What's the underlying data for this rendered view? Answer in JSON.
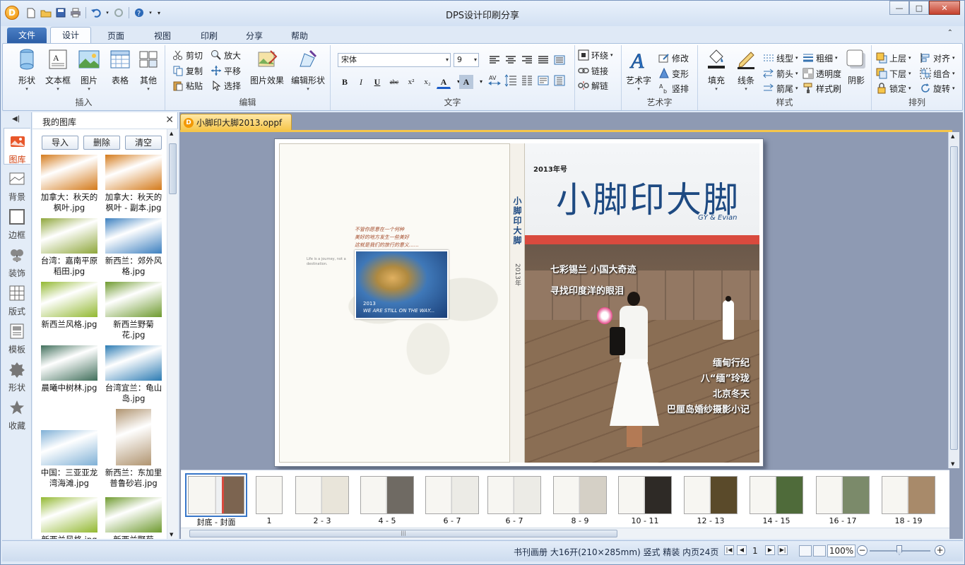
{
  "window": {
    "title": "DPS设计印刷分享",
    "logo_letter": "D",
    "minimize": "—",
    "maximize": "□",
    "close": "✕"
  },
  "ribbon_tabs": {
    "file": "文件",
    "tabs": [
      "设计",
      "页面",
      "视图",
      "印刷",
      "分享",
      "帮助"
    ],
    "active": "设计"
  },
  "groups": {
    "insert": {
      "label": "插入",
      "shape": "形状",
      "textbox": "文本框",
      "image": "图片",
      "table": "表格",
      "other": "其他"
    },
    "edit": {
      "label": "编辑",
      "cut": "剪切",
      "copy": "复制",
      "paste": "粘贴",
      "zoom": "放大",
      "pan": "平移",
      "select": "选择",
      "image_effect": "图片效果",
      "edit_shape": "编辑形状"
    },
    "text": {
      "label": "文字",
      "font": "宋体",
      "size": "9",
      "bold": "B",
      "italic": "I",
      "underline": "U",
      "strike": "abc",
      "superscript": "x²",
      "subscript": "x₂",
      "font_color": "A",
      "highlight": "A",
      "wrap": "环绕",
      "link": "链接",
      "unlink": "解链"
    },
    "art": {
      "label": "艺术字",
      "arttext": "艺术字",
      "modify": "修改",
      "transform": "变形",
      "vertical": "竖排"
    },
    "style": {
      "label": "样式",
      "fill": "填充",
      "line": "线条",
      "linetype": "线型",
      "arrow": "箭头",
      "tail": "箭尾",
      "weight": "粗细",
      "transparency": "透明度",
      "format_brush": "样式刷",
      "shadow": "阴影"
    },
    "arrange": {
      "label": "排列",
      "up": "上层",
      "down": "下层",
      "lock": "锁定",
      "align": "对齐",
      "group": "组合",
      "rotate": "旋转"
    }
  },
  "left_tabs": [
    {
      "label": "图库",
      "icon": "gallery-icon"
    },
    {
      "label": "背景",
      "icon": "background-icon"
    },
    {
      "label": "边框",
      "icon": "border-icon"
    },
    {
      "label": "装饰",
      "icon": "decoration-icon"
    },
    {
      "label": "版式",
      "icon": "layout-icon"
    },
    {
      "label": "模板",
      "icon": "template-icon"
    },
    {
      "label": "形状",
      "icon": "shape-icon"
    },
    {
      "label": "收藏",
      "icon": "star-icon"
    }
  ],
  "gallery": {
    "title": "我的图库",
    "close": "✕",
    "import": "导入",
    "delete": "删除",
    "clear": "清空",
    "items": [
      {
        "caption": "加拿大：秋天的枫叶.jpg",
        "color": "#d47a1a"
      },
      {
        "caption": "加拿大：秋天的枫叶 - 副本.jpg",
        "color": "#d47a1a"
      },
      {
        "caption": "台湾：嘉南平原稻田.jpg",
        "color": "#8ea63a"
      },
      {
        "caption": "新西兰：郊外风格.jpg",
        "color": "#3b7fbf"
      },
      {
        "caption": "新西兰风格.jpg",
        "color": "#92b830"
      },
      {
        "caption": "新西兰野菊花.jpg",
        "color": "#6e9a2e"
      },
      {
        "caption": "晨曦中树林.jpg",
        "color": "#3f6e5a"
      },
      {
        "caption": "台湾宜兰：龟山岛.jpg",
        "color": "#2b7bb3"
      },
      {
        "caption": "中国：三亚亚龙湾海滩.jpg",
        "color": "#7fb0d6"
      },
      {
        "caption": "新西兰：东加里普鲁砂岩.jpg",
        "color": "#b09470"
      },
      {
        "caption": "新西兰风格.jpg",
        "color": "#92b830"
      },
      {
        "caption": "新西兰野菊花.jpg",
        "color": "#6e9a2e"
      }
    ]
  },
  "document": {
    "tab": "小脚印大脚2013.oppf",
    "cover": {
      "issue": "2013年号",
      "title": "小脚印大脚",
      "signature": "GY & Evian",
      "spine_title": "小脚印大脚",
      "spine_year": "2013年",
      "headlines": [
        "七彩锡兰 小国大奇迹",
        "寻找印度洋的眼泪"
      ],
      "articles": [
        "缅甸行纪",
        "八“缅”玲珑",
        "北京冬天",
        "巴厘岛婚纱摄影小记"
      ]
    },
    "left_page": {
      "hand_note": [
        "不管你愿意在一个何种",
        "美好的地方发生一些美好",
        "这就是我们的旅行的意义……"
      ],
      "photo_year": "2013",
      "photo_caption": "WE ARE STILL ON THE WAY...",
      "small_note": "Life is a journey, not a destination."
    }
  },
  "filmstrip": [
    {
      "label": "封底 - 封面"
    },
    {
      "label": "1"
    },
    {
      "label": "2 - 3"
    },
    {
      "label": "4 - 5"
    },
    {
      "label": "6 - 7"
    },
    {
      "label": "6 - 7"
    },
    {
      "label": "8 - 9"
    },
    {
      "label": "10 - 11"
    },
    {
      "label": "12 - 13"
    },
    {
      "label": "14 - 15"
    },
    {
      "label": "16 - 17"
    },
    {
      "label": "18 - 19"
    }
  ],
  "filmstrip_scroll_grip": "|||",
  "status": {
    "info": "书刊画册 大16开(210×285mm) 竖式 精装 内页24页",
    "page": "1",
    "zoom": "100%",
    "zoom_minus": "−",
    "zoom_plus": "+",
    "nav_first": "|◀",
    "nav_prev": "◀",
    "nav_next": "▶",
    "nav_last": "▶|"
  },
  "colors": {
    "accent": "#2c5ea6",
    "doc_tab": "#f6c64a",
    "cover_title": "#1e4a82",
    "cover_band": "#d94a3e"
  }
}
